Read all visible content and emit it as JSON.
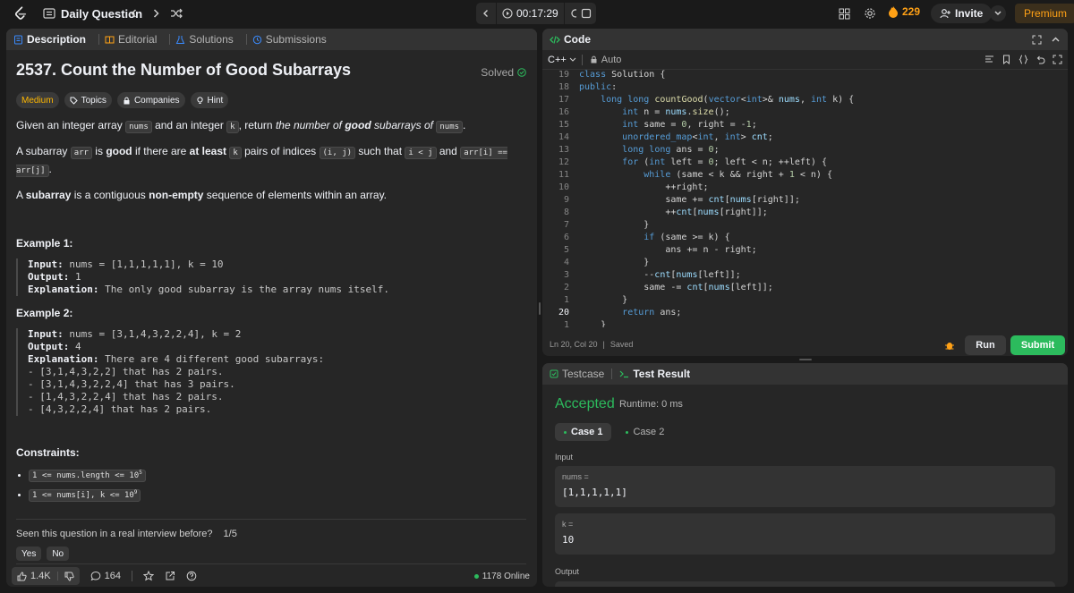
{
  "topbar": {
    "title": "Daily Question",
    "timer": "00:17:29",
    "streak": "229",
    "invite": "Invite",
    "premium": "Premium"
  },
  "left_tabs": [
    "Description",
    "Editorial",
    "Solutions",
    "Submissions"
  ],
  "problem": {
    "title": "2537. Count the Number of Good Subarrays",
    "status": "Solved",
    "difficulty": "Medium",
    "chips": [
      "Topics",
      "Companies",
      "Hint"
    ],
    "para1": {
      "t1": "Given an integer array ",
      "c1": "nums",
      "t2": " and an integer ",
      "c2": "k",
      "t3": ", return ",
      "e1": "the number of ",
      "e2": "good",
      "e3": " subarrays of ",
      "c3": "nums",
      "t4": "."
    },
    "para2": {
      "t1": "A subarray ",
      "c1": "arr",
      "t2": " is ",
      "b1": "good",
      "t3": " if there are ",
      "b2": "at least",
      "t4": " ",
      "c2": "k",
      "t5": " pairs of indices ",
      "c3": "(i, j)",
      "t6": " such that ",
      "c4": "i < j",
      "t7": " and ",
      "c5": "arr[i] == arr[j]",
      "t8": "."
    },
    "para3": {
      "t1": "A ",
      "b1": "subarray",
      "t2": " is a contiguous ",
      "b2": "non-empty",
      "t3": " sequence of elements within an array."
    },
    "examples": [
      {
        "title": "Example 1:",
        "input_label": "Input:",
        "input": " nums = [1,1,1,1,1], k = 10",
        "output_label": "Output:",
        "output": " 1",
        "explanation_label": "Explanation:",
        "explanation": " The only good subarray is the array nums itself."
      },
      {
        "title": "Example 2:",
        "input_label": "Input:",
        "input": " nums = [3,1,4,3,2,2,4], k = 2",
        "output_label": "Output:",
        "output": " 4",
        "explanation_label": "Explanation:",
        "explanation": " There are 4 different good subarrays:\n- [3,1,4,3,2,2] that has 2 pairs.\n- [3,1,4,3,2,2,4] that has 3 pairs.\n- [1,4,3,2,2,4] that has 2 pairs.\n- [4,3,2,2,4] that has 2 pairs."
      }
    ],
    "constraints_title": "Constraints:",
    "constraints": [
      {
        "text": "1 <= nums.length <= 10",
        "sup": "5"
      },
      {
        "text": "1 <= nums[i], k <= 10",
        "sup": "9"
      }
    ],
    "seen_question": "Seen this question in a real interview before?",
    "seen_page": "1/5",
    "yes": "Yes",
    "no": "No",
    "likes": "1.4K",
    "comments": "164",
    "online": "1178 Online"
  },
  "code_panel": {
    "title": "Code",
    "language": "C++",
    "mode": "Auto",
    "status_pos": "Ln 20, Col 20",
    "status_saved": "Saved",
    "run": "Run",
    "submit": "Submit",
    "lines": [
      {
        "n": "19",
        "code": "class Solution {"
      },
      {
        "n": "18",
        "code": "public:"
      },
      {
        "n": "17",
        "code": "    long long countGood(vector<int>& nums, int k) {"
      },
      {
        "n": "16",
        "code": "        int n = nums.size();"
      },
      {
        "n": "15",
        "code": "        int same = 0, right = -1;"
      },
      {
        "n": "14",
        "code": "        unordered_map<int, int> cnt;"
      },
      {
        "n": "13",
        "code": "        long long ans = 0;"
      },
      {
        "n": "12",
        "code": "        for (int left = 0; left < n; ++left) {"
      },
      {
        "n": "11",
        "code": "            while (same < k && right + 1 < n) {"
      },
      {
        "n": "10",
        "code": "                ++right;"
      },
      {
        "n": "9",
        "code": "                same += cnt[nums[right]];"
      },
      {
        "n": "8",
        "code": "                ++cnt[nums[right]];"
      },
      {
        "n": "7",
        "code": "            }"
      },
      {
        "n": "6",
        "code": "            if (same >= k) {"
      },
      {
        "n": "5",
        "code": "                ans += n - right;"
      },
      {
        "n": "4",
        "code": "            }"
      },
      {
        "n": "3",
        "code": "            --cnt[nums[left]];"
      },
      {
        "n": "2",
        "code": "            same -= cnt[nums[left]];"
      },
      {
        "n": "1",
        "code": "        }"
      },
      {
        "n": "20",
        "code": "        return ans;",
        "current": true
      },
      {
        "n": "1",
        "code": "    }"
      }
    ]
  },
  "result_panel": {
    "tabs": [
      "Testcase",
      "Test Result"
    ],
    "verdict": "Accepted",
    "runtime": "Runtime: 0 ms",
    "cases": [
      "Case 1",
      "Case 2"
    ],
    "input_label": "Input",
    "fields": [
      {
        "name": "nums =",
        "value": "[1,1,1,1,1]"
      },
      {
        "name": "k =",
        "value": "10"
      }
    ],
    "output_label": "Output"
  },
  "colors": {
    "accent": "#ffa116",
    "success": "#2cbb5d",
    "medium": "#ffb800",
    "panel": "#262626",
    "background": "#1a1a1a"
  }
}
